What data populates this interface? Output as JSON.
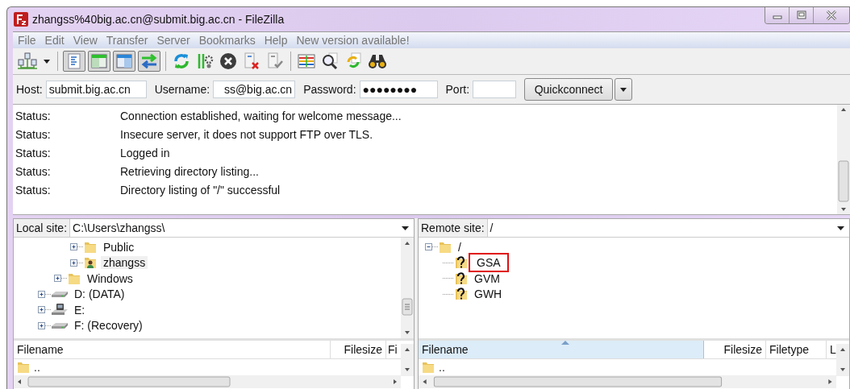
{
  "window": {
    "title": "zhangss%40big.ac.cn@submit.big.ac.cn - FileZilla"
  },
  "menu": [
    "File",
    "Edit",
    "View",
    "Transfer",
    "Server",
    "Bookmarks",
    "Help",
    "New version available!"
  ],
  "toolbar_toggles": [
    {
      "on": true
    },
    {
      "on": true
    },
    {
      "on": true
    },
    {
      "on": true
    }
  ],
  "quickconnect": {
    "host_label": "Host:",
    "host": "submit.big.ac.cn",
    "username_label": "Username:",
    "username": "ss@big.ac.cn",
    "password_label": "Password:",
    "password": "●●●●●●●●",
    "port_label": "Port:",
    "button": "Quickconnect"
  },
  "log": [
    {
      "label": "Status:",
      "message": "Connection established, waiting for welcome message..."
    },
    {
      "label": "Status:",
      "message": "Insecure server, it does not support FTP over TLS."
    },
    {
      "label": "Status:",
      "message": "Logged in"
    },
    {
      "label": "Status:",
      "message": "Retrieving directory listing..."
    },
    {
      "label": "Status:",
      "message": "Directory listing of \"/\" successful"
    }
  ],
  "local": {
    "label": "Local site:",
    "path": "C:\\Users\\zhangss\\",
    "tree": [
      {
        "children": [
          {
            "children": [
              {
                "label": "Public",
                "kind": "folder",
                "expanded": false,
                "selected": false
              },
              {
                "label": "zhangss",
                "kind": "user-folder",
                "expanded": false,
                "selected": true
              }
            ]
          },
          {
            "label": "Windows",
            "kind": "folder",
            "expanded": false,
            "selected": false
          }
        ]
      },
      {
        "label": "D: (DATA)",
        "kind": "drive",
        "expanded": false,
        "selected": false
      },
      {
        "label": "E:",
        "kind": "network-drive",
        "expanded": false,
        "selected": false
      },
      {
        "label": "F: (Recovery)",
        "kind": "drive",
        "expanded": false,
        "selected": false
      }
    ],
    "columns": [
      {
        "label": "Filename",
        "sorted": false
      },
      {
        "label": "Filesize",
        "sorted": false
      },
      {
        "label": "Fi",
        "sorted": false
      }
    ],
    "rows": [
      {
        "name": ".."
      }
    ]
  },
  "remote": {
    "label": "Remote site:",
    "path": "/",
    "tree": [
      {
        "label": "/",
        "kind": "folder",
        "expanded": true,
        "selected": false,
        "children": [
          {
            "label": "GSA",
            "kind": "unknown-folder",
            "selected": false,
            "highlighted": true
          },
          {
            "label": "GVM",
            "kind": "unknown-folder",
            "selected": false,
            "highlighted": false
          },
          {
            "label": "GWH",
            "kind": "unknown-folder",
            "selected": false,
            "highlighted": false
          }
        ]
      }
    ],
    "columns": [
      {
        "label": "Filename",
        "sorted": true
      },
      {
        "label": "Filesize",
        "sorted": false
      },
      {
        "label": "Filetype",
        "sorted": false
      },
      {
        "label": "L",
        "sorted": false
      }
    ],
    "rows": [
      {
        "name": ".."
      }
    ]
  }
}
